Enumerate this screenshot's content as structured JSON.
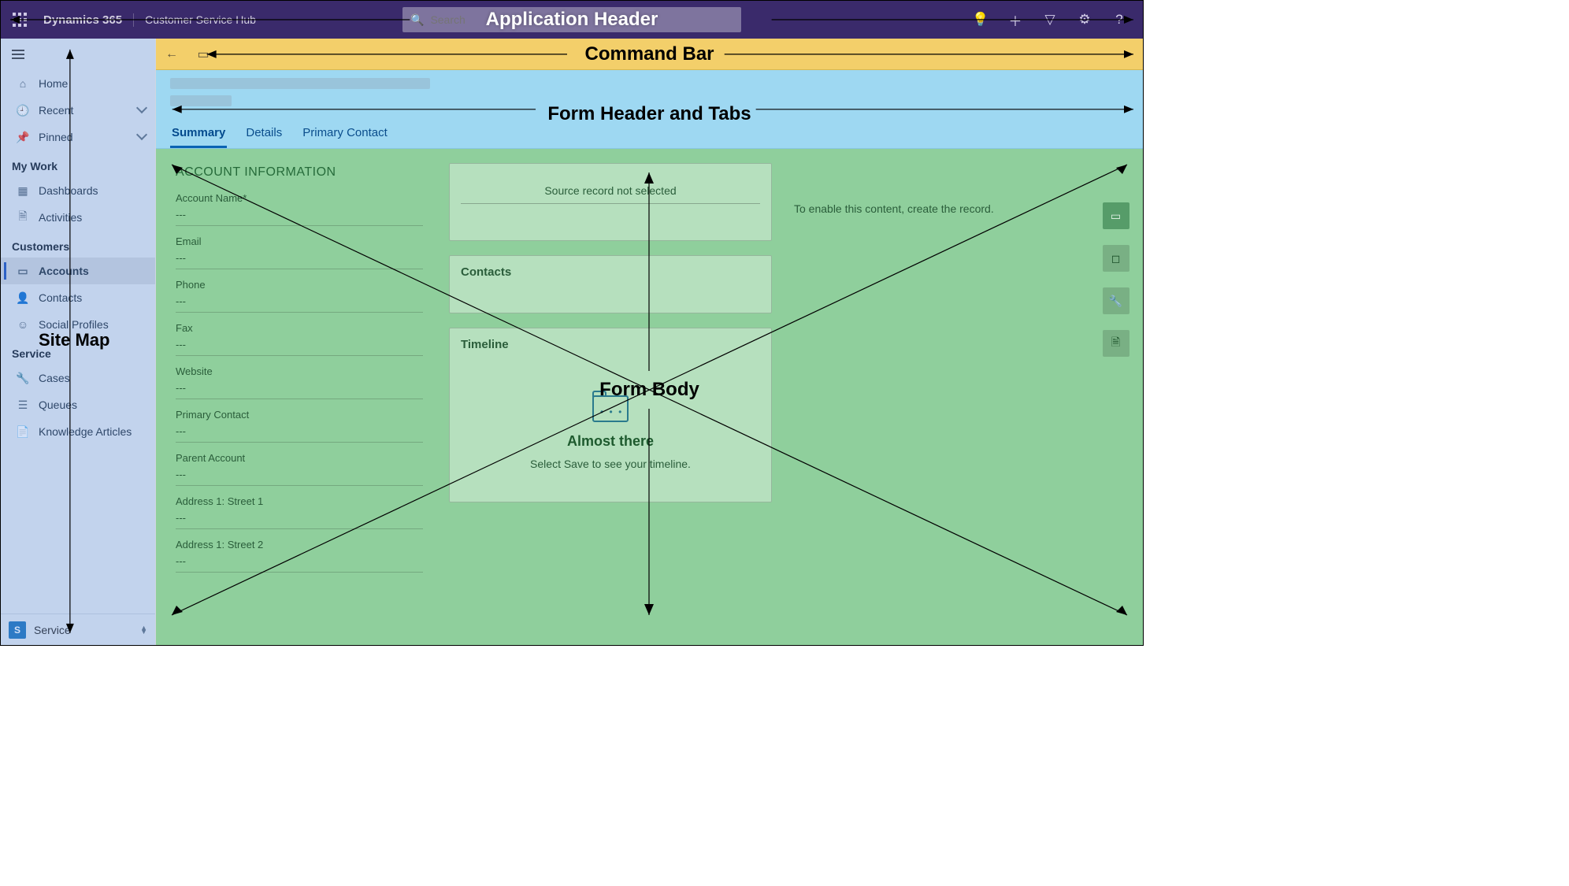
{
  "header": {
    "brand": "Dynamics 365",
    "subapp": "Customer Service Hub",
    "search_placeholder": "Search",
    "overlay_label": "Application Header"
  },
  "command_bar": {
    "overlay_label": "Command Bar"
  },
  "form_header": {
    "overlay_label": "Form Header and Tabs",
    "tabs": [
      {
        "label": "Summary",
        "active": true
      },
      {
        "label": "Details",
        "active": false
      },
      {
        "label": "Primary Contact",
        "active": false
      }
    ]
  },
  "form_body": {
    "overlay_label": "Form Body",
    "section_title": "ACCOUNT INFORMATION",
    "empty_value": "---",
    "fields": [
      {
        "label": "Account Name*"
      },
      {
        "label": "Email"
      },
      {
        "label": "Phone"
      },
      {
        "label": "Fax"
      },
      {
        "label": "Website"
      },
      {
        "label": "Primary Contact"
      },
      {
        "label": "Parent Account"
      },
      {
        "label": "Address 1: Street 1"
      },
      {
        "label": "Address 1: Street 2"
      }
    ],
    "source_note": "Source record not selected",
    "contacts_title": "Contacts",
    "timeline": {
      "title": "Timeline",
      "headline": "Almost there",
      "subtext": "Select Save to see your timeline."
    },
    "right_note": "To enable this content, create the record."
  },
  "sidebar": {
    "overlay_label": "Site Map",
    "top": [
      {
        "icon": "home",
        "label": "Home"
      },
      {
        "icon": "recent",
        "label": "Recent",
        "expandable": true
      },
      {
        "icon": "pin",
        "label": "Pinned",
        "expandable": true
      }
    ],
    "groups": [
      {
        "title": "My Work",
        "items": [
          {
            "icon": "dash",
            "label": "Dashboards"
          },
          {
            "icon": "act",
            "label": "Activities"
          }
        ]
      },
      {
        "title": "Customers",
        "items": [
          {
            "icon": "acct",
            "label": "Accounts",
            "selected": true
          },
          {
            "icon": "cont",
            "label": "Contacts"
          },
          {
            "icon": "soc",
            "label": "Social Profiles"
          }
        ]
      },
      {
        "title": "Service",
        "items": [
          {
            "icon": "case",
            "label": "Cases"
          },
          {
            "icon": "queue",
            "label": "Queues"
          },
          {
            "icon": "ka",
            "label": "Knowledge Articles"
          }
        ]
      }
    ],
    "area_switch": {
      "badge": "S",
      "label": "Service"
    }
  }
}
